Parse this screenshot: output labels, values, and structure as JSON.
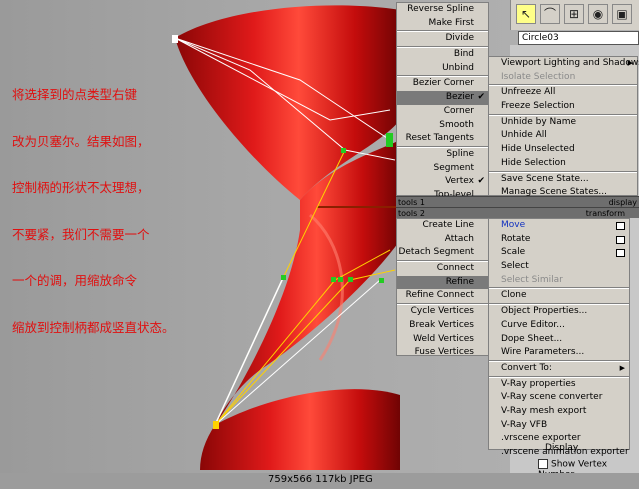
{
  "annotation_lines": [
    "将选择到的点类型右键",
    "改为贝塞尔。结果如图，",
    "控制柄的形状不太理想，",
    "不要紧，我们不需要一个",
    "一个的调，用缩放命令",
    "缩放到控制柄都成竖直状态。"
  ],
  "quad_left_top": [
    {
      "label": "Reverse Spline"
    },
    {
      "label": "Make First"
    },
    {
      "sep": true
    },
    {
      "label": "Divide"
    },
    {
      "sep": true
    },
    {
      "label": "Bind"
    },
    {
      "label": "Unbind"
    },
    {
      "sep": true
    },
    {
      "label": "Bezier Corner"
    },
    {
      "label": "Bezier",
      "check": "✔",
      "highlight": true
    },
    {
      "label": "Corner"
    },
    {
      "label": "Smooth"
    },
    {
      "label": "Reset Tangents"
    },
    {
      "sep": true
    },
    {
      "label": "Spline"
    },
    {
      "label": "Segment"
    },
    {
      "label": "Vertex",
      "check": "✔"
    },
    {
      "label": "Top-level"
    }
  ],
  "quad_right_top": [
    {
      "label": "Viewport Lighting and Shadows",
      "arrow": "▶"
    },
    {
      "label": "Isolate Selection",
      "disabled": true
    },
    {
      "sep": true
    },
    {
      "label": "Unfreeze All"
    },
    {
      "label": "Freeze Selection"
    },
    {
      "sep": true
    },
    {
      "label": "Unhide by Name"
    },
    {
      "label": "Unhide All"
    },
    {
      "label": "Hide Unselected"
    },
    {
      "label": "Hide Selection"
    },
    {
      "sep": true
    },
    {
      "label": "Save Scene State..."
    },
    {
      "label": "Manage Scene States..."
    }
  ],
  "bar_tools1": {
    "left": "tools 1",
    "right": "display"
  },
  "bar_tools2": {
    "left": "tools 2",
    "right": "transform"
  },
  "quad_left_bottom": [
    {
      "label": "Create Line"
    },
    {
      "label": "Attach"
    },
    {
      "label": "Detach Segment"
    },
    {
      "sep": true
    },
    {
      "label": "Connect"
    },
    {
      "label": "Refine",
      "highlight": true
    },
    {
      "label": "Refine Connect"
    },
    {
      "sep": true
    },
    {
      "label": "Cycle Vertices"
    },
    {
      "label": "Break Vertices"
    },
    {
      "label": "Weld Vertices"
    },
    {
      "label": "Fuse Vertices"
    }
  ],
  "quad_right_bottom": [
    {
      "label": "Move",
      "blue": true,
      "box": true
    },
    {
      "label": "Rotate",
      "box": true
    },
    {
      "label": "Scale",
      "box": true
    },
    {
      "label": "Select"
    },
    {
      "label": "Select Similar",
      "disabled": true
    },
    {
      "sep": true
    },
    {
      "label": "Clone"
    },
    {
      "sep": true
    },
    {
      "label": "Object Properties..."
    },
    {
      "label": "Curve Editor..."
    },
    {
      "label": "Dope Sheet..."
    },
    {
      "label": "Wire Parameters..."
    },
    {
      "sep": true
    },
    {
      "label": "Convert To:",
      "arrow": "▶"
    },
    {
      "sep": true
    },
    {
      "label": "V-Ray properties"
    },
    {
      "label": "V-Ray scene converter"
    },
    {
      "label": "V-Ray mesh export"
    },
    {
      "label": "V-Ray VFB"
    },
    {
      "label": ".vrscene exporter"
    },
    {
      "label": ".vrscene animation exporter"
    }
  ],
  "object_name": "Circle03",
  "panel": {
    "display_label": "Display",
    "show_vertex_label": "Show Vertex Number"
  },
  "caption": "759x566  117kb  JPEG",
  "colors": {
    "shape_red": "#d81414",
    "handle_green": "#22cc22",
    "note_red": "#e01010",
    "menu_bg": "#d4d0c8"
  }
}
